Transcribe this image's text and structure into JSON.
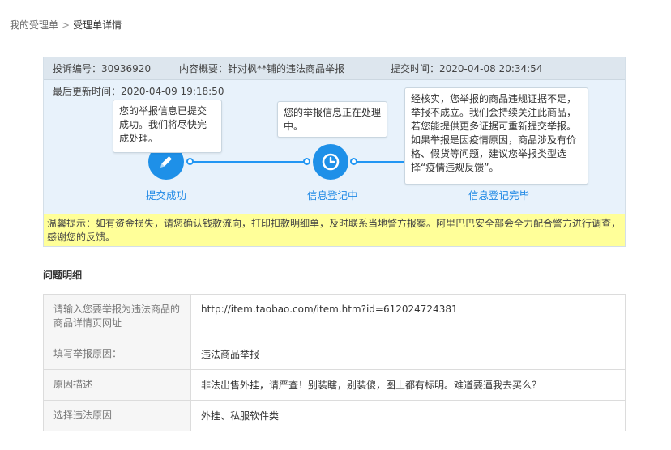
{
  "breadcrumb": {
    "parent": "我的受理单",
    "separator": ">",
    "current": "受理单详情"
  },
  "header": {
    "complaint_no": "投诉编号：30936920",
    "summary": "内容概要：针对枫**铺的违法商品举报",
    "submit_time": "提交时间：2020-04-08 20:34:54"
  },
  "last_updated": "最后更新时间：2020-04-09 19:18:50",
  "steps": [
    {
      "label": "提交成功",
      "bubble": "您的举报信息已提交成功。我们将尽快完成处理。"
    },
    {
      "label": "信息登记中",
      "bubble": "您的举报信息正在处理中。"
    },
    {
      "label": "信息登记完毕",
      "bubble": "经核实，您举报的商品违规证据不足，举报不成立。我们会持续关注此商品，若您能提供更多证据可重新提交举报。如果举报是因疫情原因，商品涉及有价格、假货等问题，建议您举报类型选择“疫情违规反馈”。"
    }
  ],
  "notice": "温馨提示：如有资金损失，请您确认钱款流向，打印扣款明细单，及时联系当地警方报案。阿里巴巴安全部会全力配合警方进行调查，感谢您的反馈。",
  "details": {
    "title": "问题明细",
    "rows": [
      {
        "key": "请输入您要举报为违法商品的商品详情页网址",
        "value": "http://item.taobao.com/item.htm?id=612024724381"
      },
      {
        "key": "填写举报原因：",
        "value": "违法商品举报"
      },
      {
        "key": "原因描述",
        "value": "非法出售外挂，请严查！别装瞎，别装傻，图上都有标明。难道要逼我去买么？"
      },
      {
        "key": "选择违法原因",
        "value": "外挂、私服软件类"
      }
    ]
  },
  "colors": {
    "accent": "#1e90e8",
    "notice_bg": "#ffff99",
    "panel_bg": "#e8f2fb"
  },
  "icons": [
    "pencil-icon",
    "clock-icon"
  ]
}
